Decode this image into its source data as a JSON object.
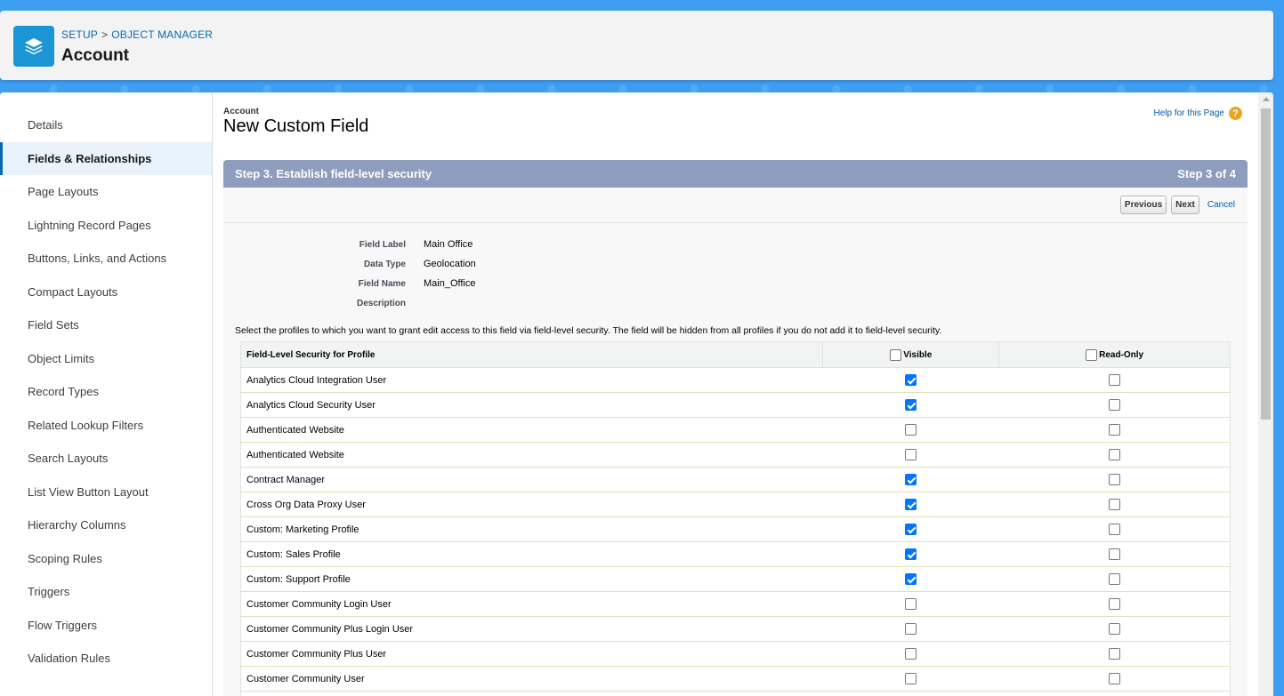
{
  "header": {
    "breadcrumb": {
      "setup": "SETUP",
      "separator": ">",
      "object_manager": "OBJECT MANAGER"
    },
    "title": "Account",
    "icon": "layers-icon"
  },
  "sidebar": {
    "items": [
      {
        "label": "Details",
        "active": false
      },
      {
        "label": "Fields & Relationships",
        "active": true
      },
      {
        "label": "Page Layouts",
        "active": false
      },
      {
        "label": "Lightning Record Pages",
        "active": false
      },
      {
        "label": "Buttons, Links, and Actions",
        "active": false
      },
      {
        "label": "Compact Layouts",
        "active": false
      },
      {
        "label": "Field Sets",
        "active": false
      },
      {
        "label": "Object Limits",
        "active": false
      },
      {
        "label": "Record Types",
        "active": false
      },
      {
        "label": "Related Lookup Filters",
        "active": false
      },
      {
        "label": "Search Layouts",
        "active": false
      },
      {
        "label": "List View Button Layout",
        "active": false
      },
      {
        "label": "Hierarchy Columns",
        "active": false
      },
      {
        "label": "Scoping Rules",
        "active": false
      },
      {
        "label": "Triggers",
        "active": false
      },
      {
        "label": "Flow Triggers",
        "active": false
      },
      {
        "label": "Validation Rules",
        "active": false
      }
    ]
  },
  "form": {
    "object_name": "Account",
    "title": "New Custom Field",
    "help_link": "Help for this Page",
    "step_title": "Step 3. Establish field-level security",
    "step_counter": "Step 3 of 4",
    "buttons": {
      "previous": "Previous",
      "next": "Next",
      "cancel": "Cancel"
    },
    "info": [
      {
        "label": "Field Label",
        "value": "Main Office"
      },
      {
        "label": "Data Type",
        "value": "Geolocation"
      },
      {
        "label": "Field Name",
        "value": "Main_Office"
      },
      {
        "label": "Description",
        "value": ""
      }
    ],
    "instructions": "Select the profiles to which you want to grant edit access to this field via field-level security. The field will be hidden from all profiles if you do not add it to field-level security."
  },
  "table": {
    "headers": {
      "profile": "Field-Level Security for Profile",
      "visible": "Visible",
      "read_only": "Read-Only"
    },
    "rows": [
      {
        "profile": "Analytics Cloud Integration User",
        "visible": true,
        "read_only": false
      },
      {
        "profile": "Analytics Cloud Security User",
        "visible": true,
        "read_only": false
      },
      {
        "profile": "Authenticated Website",
        "visible": false,
        "read_only": false
      },
      {
        "profile": "Authenticated Website",
        "visible": false,
        "read_only": false
      },
      {
        "profile": "Contract Manager",
        "visible": true,
        "read_only": false
      },
      {
        "profile": "Cross Org Data Proxy User",
        "visible": true,
        "read_only": false
      },
      {
        "profile": "Custom: Marketing Profile",
        "visible": true,
        "read_only": false
      },
      {
        "profile": "Custom: Sales Profile",
        "visible": true,
        "read_only": false
      },
      {
        "profile": "Custom: Support Profile",
        "visible": true,
        "read_only": false
      },
      {
        "profile": "Customer Community Login User",
        "visible": false,
        "read_only": false
      },
      {
        "profile": "Customer Community Plus Login User",
        "visible": false,
        "read_only": false
      },
      {
        "profile": "Customer Community Plus User",
        "visible": false,
        "read_only": false
      },
      {
        "profile": "Customer Community User",
        "visible": false,
        "read_only": false
      },
      {
        "profile": "",
        "visible": false,
        "read_only": false
      }
    ]
  },
  "colors": {
    "accent": "#1b96d4",
    "link": "#015ba7",
    "step_bar": "#8e9dbe",
    "checkbox_checked": "#0075ff"
  }
}
